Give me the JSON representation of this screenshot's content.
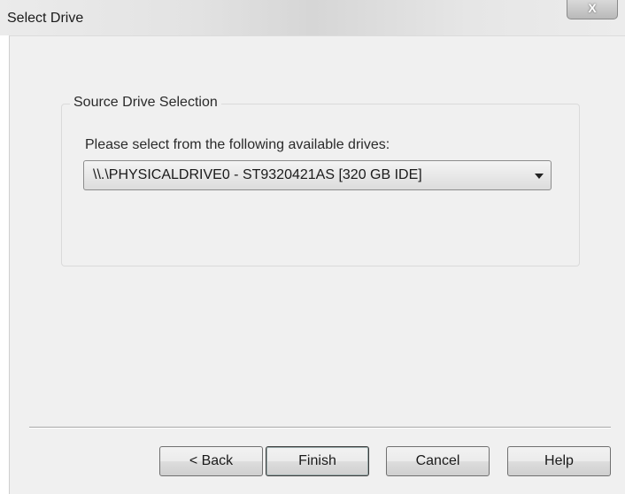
{
  "window": {
    "title": "Select Drive",
    "close_glyph": "X"
  },
  "group": {
    "legend": "Source Drive Selection",
    "prompt": "Please select from the following available drives:"
  },
  "drive_select": {
    "selected_value": "\\\\.\\PHYSICALDRIVE0 - ST9320421AS [320 GB IDE]"
  },
  "buttons": {
    "back": "< Back",
    "finish": "Finish",
    "cancel": "Cancel",
    "help": "Help"
  },
  "icons": {
    "close": "close-icon",
    "dropdown": "chevron-down-icon"
  }
}
